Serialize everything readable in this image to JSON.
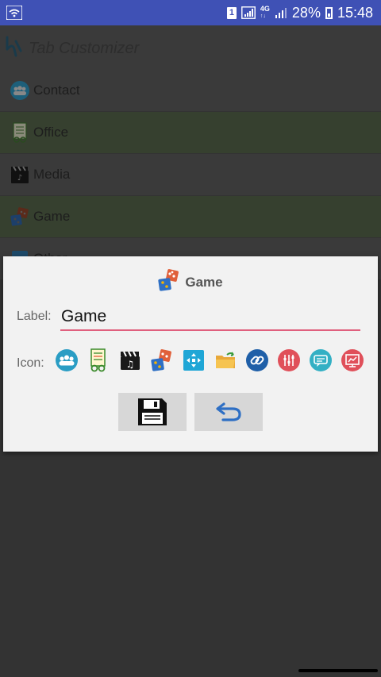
{
  "status_bar": {
    "sim_slot": "1",
    "network_type": "4G",
    "network_sub": "↑↓",
    "battery_percent": "28%",
    "time": "15:48"
  },
  "app": {
    "title": "Tab Customizer"
  },
  "tabs": [
    {
      "label": "Contact",
      "icon": "contacts-icon"
    },
    {
      "label": "Office",
      "icon": "office-document-icon"
    },
    {
      "label": "Media",
      "icon": "media-clapper-icon"
    },
    {
      "label": "Game",
      "icon": "game-dice-icon"
    },
    {
      "label": "Other",
      "icon": "other-icon"
    }
  ],
  "dialog": {
    "title": "Game",
    "title_icon": "game-dice-icon",
    "label_caption": "Label:",
    "label_value": "Game",
    "icon_caption": "Icon:",
    "icon_options": [
      "contacts-icon",
      "office-document-icon",
      "media-clapper-icon",
      "game-dice-icon",
      "move-arrows-icon",
      "folder-icon",
      "link-icon",
      "equalizer-icon",
      "chat-icon",
      "presentation-icon"
    ],
    "save_button": "save-icon",
    "back_button": "undo-icon"
  },
  "colors": {
    "status_bar": "#3f51b5",
    "input_underline": "#e0607e",
    "dialog_bg": "#f2f2f2"
  }
}
